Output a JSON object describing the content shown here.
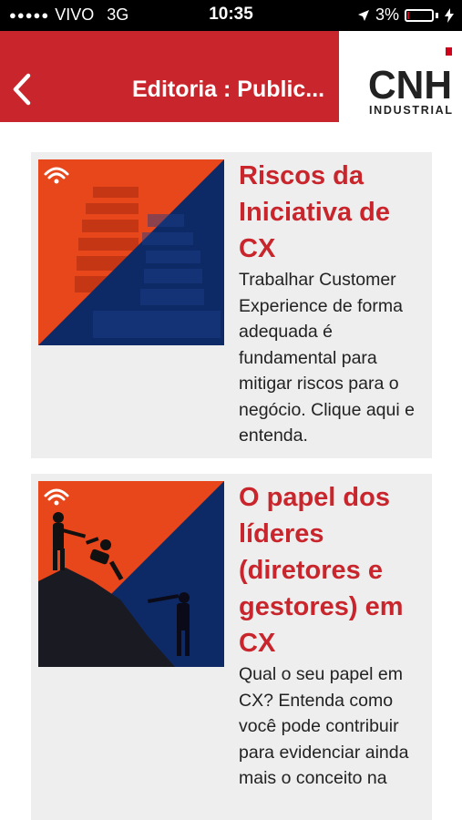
{
  "status_bar": {
    "carrier": "VIVO",
    "network": "3G",
    "time": "10:35",
    "battery_percent_label": "3%",
    "battery_level": 0.03
  },
  "header": {
    "title": "Editoria : Public...",
    "logo_text_main": "CNH",
    "logo_text_sub": "INDUSTRIAL",
    "colors": {
      "bar": "#c8262c",
      "logo_accent": "#d0021b"
    }
  },
  "articles": [
    {
      "title": "Riscos da Iniciativa de CX",
      "description": "Trabalhar Customer Experience de forma adequada é fundamental para mitigar riscos para o negócio. Clique aqui e entenda.",
      "image_icon": "wifi-signal-icon"
    },
    {
      "title": "O papel dos líderes (diretores e gestores) em CX",
      "description": "Qual o seu papel em CX? Entenda como você pode contribuir para evidenciar ainda mais o conceito na",
      "image_icon": "wifi-signal-icon"
    }
  ],
  "colors": {
    "accent_red": "#c8262c",
    "image_orange": "#e8461b",
    "image_navy": "#0e2a66",
    "card_background": "#eeeeee"
  }
}
